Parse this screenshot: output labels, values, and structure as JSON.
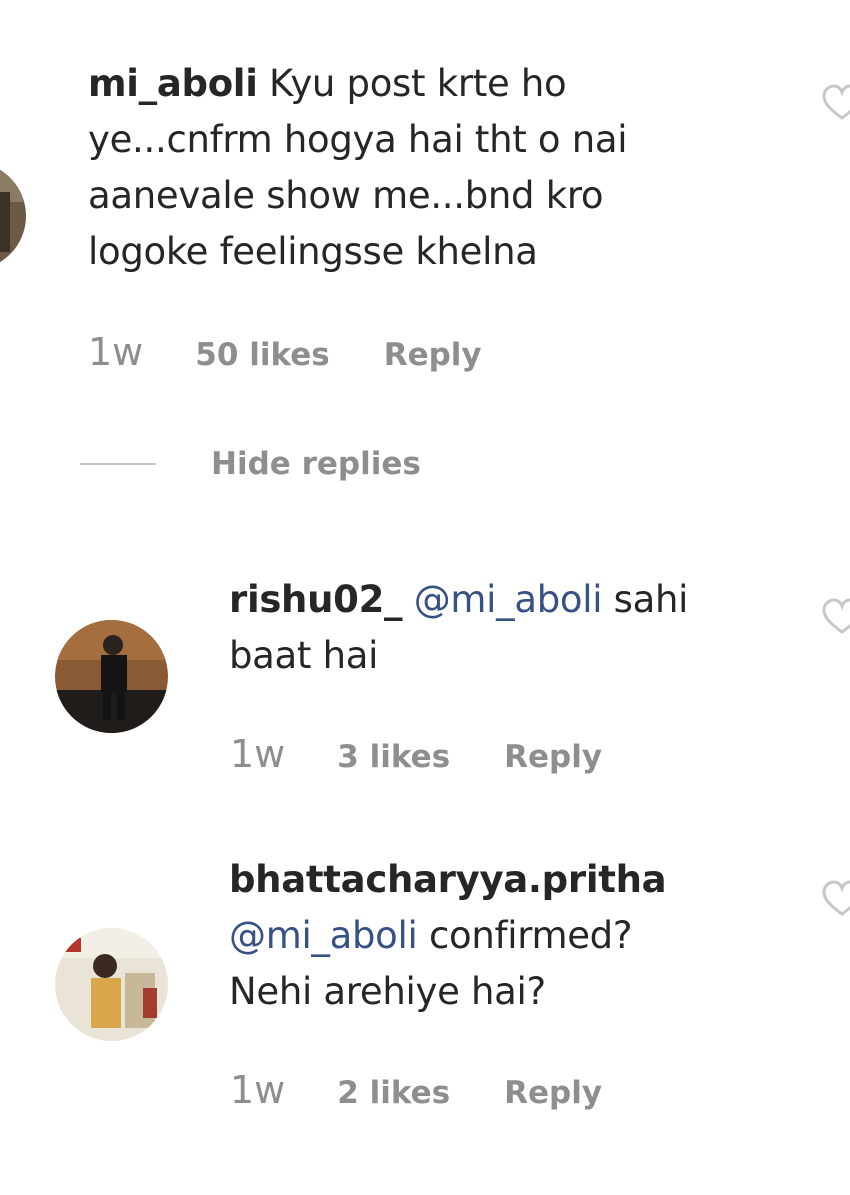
{
  "comments": [
    {
      "username": "mi_aboli",
      "text_line1": "Kyu post krte ho",
      "text_line2": "ye...cnfrm hogya hai tht o nai",
      "text_line3": "aanevale show me...bnd kro",
      "text_line4": "logoke feelingsse khelna",
      "time": "1w",
      "likes": "50 likes",
      "reply": "Reply"
    }
  ],
  "hide_replies_label": "Hide replies",
  "replies": [
    {
      "username": "rishu02_",
      "mention": "@mi_aboli",
      "text_line1": "sahi",
      "text_line2": "baat hai",
      "time": "1w",
      "likes": "3 likes",
      "reply": "Reply"
    },
    {
      "username": "bhattacharyya.pritha",
      "mention": "@mi_aboli",
      "text_line1": "confirmed?",
      "text_line2": "Nehi arehiye hai?",
      "time": "1w",
      "likes": "2 likes",
      "reply": "Reply"
    }
  ],
  "icons": {
    "like": "heart-outline-icon"
  },
  "colors": {
    "text": "#262626",
    "muted": "#8e8e8e",
    "mention": "#385185"
  }
}
